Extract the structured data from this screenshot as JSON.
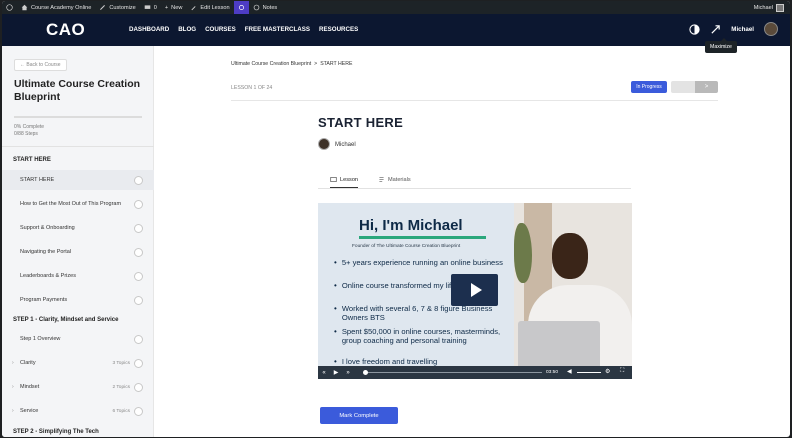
{
  "adminbar": {
    "site_name": "Course Academy Online",
    "customize": "Customize",
    "comments_count": "0",
    "new_label": "New",
    "edit_label": "Edit Lesson",
    "notes_label": "Notes",
    "user": "Michael"
  },
  "nav": {
    "logo": "CAO",
    "links": [
      "DASHBOARD",
      "BLOG",
      "COURSES",
      "FREE MASTERCLASS",
      "RESOURCES"
    ],
    "user": "Michael",
    "tooltip": "Maximize"
  },
  "sidebar": {
    "back": "← Back to Course",
    "course_title": "Ultimate Course Creation Blueprint",
    "progress_fraction": 0.0,
    "percent_label": "0% Complete",
    "steps_label": "0/88 Steps",
    "sections": [
      {
        "title": "START HERE",
        "lessons": [
          {
            "label": "START HERE",
            "topics": ""
          },
          {
            "label": "How to Get the Most Out of This Program",
            "topics": ""
          },
          {
            "label": "Support & Onboarding",
            "topics": ""
          },
          {
            "label": "Navigating the Portal",
            "topics": ""
          },
          {
            "label": "Leaderboards & Prizes",
            "topics": ""
          },
          {
            "label": "Program Payments",
            "topics": ""
          }
        ]
      },
      {
        "title": "STEP 1 - Clarity, Mindset and Service",
        "lessons": [
          {
            "label": "Step 1 Overview",
            "topics": ""
          },
          {
            "label": "Clarity",
            "topics": "3 Topics"
          },
          {
            "label": "Mindset",
            "topics": "2 Topics"
          },
          {
            "label": "Service",
            "topics": "6 Topics"
          }
        ]
      },
      {
        "title": "STEP 2 - Simplifying The Tech",
        "lessons": []
      }
    ]
  },
  "main": {
    "breadcrumb": [
      "Ultimate Course Creation Blueprint",
      ">",
      "START HERE"
    ],
    "lesson_num": "LESSON 1",
    "lesson_of": "OF 24",
    "status": "In Progress",
    "next_arrow": ">",
    "title": "START HERE",
    "author": "Michael",
    "tabs": [
      "Lesson",
      "Materials"
    ],
    "mark_complete": "Mark Complete"
  },
  "video": {
    "heading": "Hi, I'm Michael",
    "subheading": "Founder of The Ultimate Course Creation Blueprint",
    "bullets": [
      "5+ years experience running an online business",
      "Online course transformed my life",
      "Worked with several 6, 7 & 8 figure Business Owners BTS",
      "Spent $50,000 in online courses, masterminds, group coaching and personal training",
      "I love freedom and travelling"
    ],
    "time": "03:50"
  }
}
